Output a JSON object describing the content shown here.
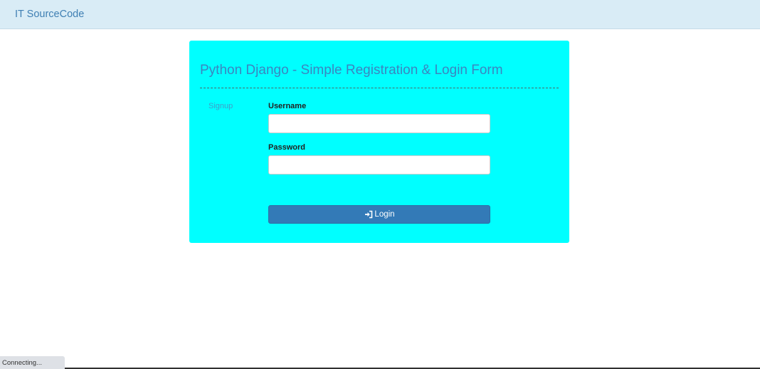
{
  "navbar": {
    "brand": "IT SourceCode"
  },
  "panel": {
    "title": "Python Django - Simple Registration & Login Form",
    "signup_link": "Signup",
    "username_label": "Username",
    "username_value": "",
    "password_label": "Password",
    "password_value": "",
    "login_button": "Login",
    "login_icon": "sign-in-icon",
    "background_color": "#00ffff",
    "button_color": "#337ab7"
  },
  "status": {
    "text": "Connecting..."
  }
}
